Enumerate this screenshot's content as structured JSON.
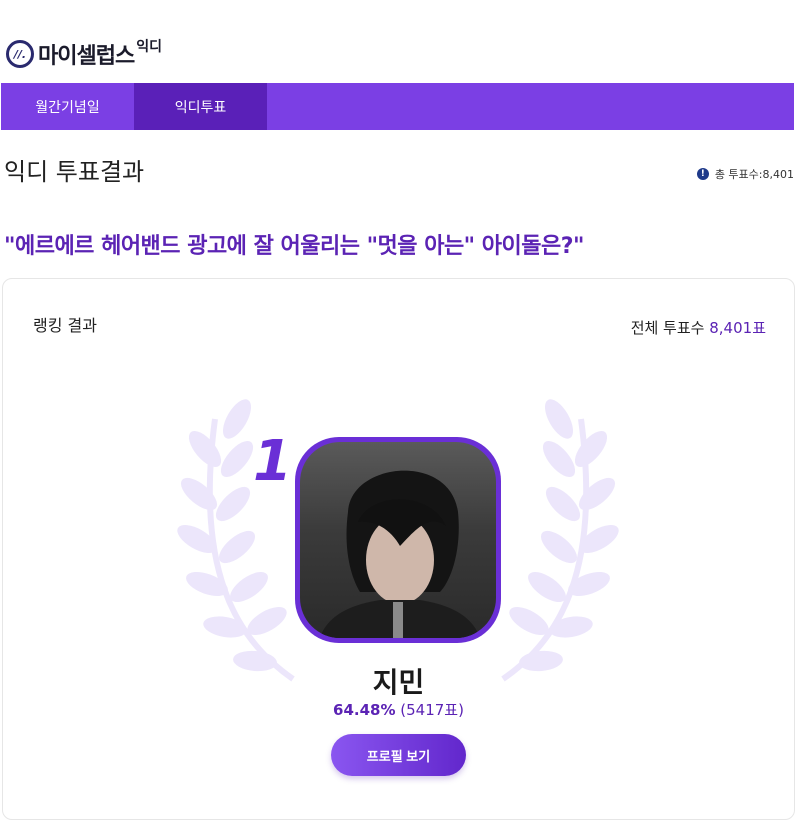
{
  "header": {
    "logo_mark": "//.",
    "logo_text": "마이셀럽스",
    "logo_sub": "익디"
  },
  "nav": {
    "items": [
      {
        "label": "월간기념일"
      },
      {
        "label": "익디투표"
      }
    ]
  },
  "page_title": "익디 투표결과",
  "total_votes_short": "총 투표수:8,401",
  "question": "\"에르에르 헤어밴드 광고에 잘 어울리는 \"멋을 아는\" 아이돌은?\"",
  "card": {
    "title": "랭킹 결과",
    "total_label": "전체 투표수",
    "total_value": "8,401표"
  },
  "winner": {
    "rank": "1",
    "name": "지민",
    "percent": "64.48%",
    "votes": "(5417표)",
    "profile_button": "프로필 보기"
  },
  "colors": {
    "accent": "#7b3fe4",
    "accent_dark": "#5a20b8",
    "text_purple": "#5b23b4",
    "laurel": "#ece6fb"
  },
  "icons": {
    "info": "info-icon",
    "laurel": "laurel-wreath-icon"
  }
}
